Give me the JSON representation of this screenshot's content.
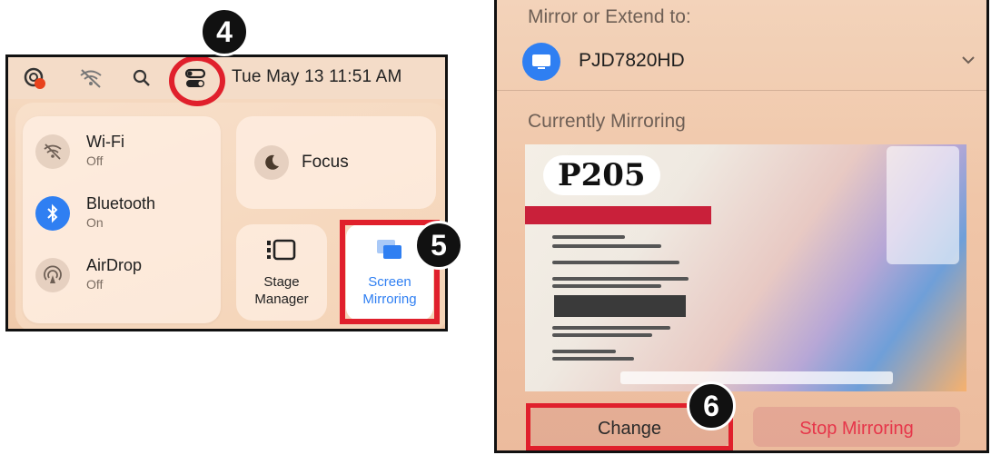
{
  "left_panel": {
    "menubar": {
      "clock": "Tue May 13  11:51 AM",
      "icons": [
        "siri-icon",
        "wifi-off-icon",
        "search-icon",
        "control-center-icon"
      ]
    },
    "connectivity": [
      {
        "title": "Wi-Fi",
        "status": "Off",
        "icon": "wifi-off-icon"
      },
      {
        "title": "Bluetooth",
        "status": "On",
        "icon": "bluetooth-icon"
      },
      {
        "title": "AirDrop",
        "status": "Off",
        "icon": "airdrop-icon"
      }
    ],
    "focus": {
      "label": "Focus",
      "icon": "moon-icon"
    },
    "stage_manager": {
      "label_line1": "Stage",
      "label_line2": "Manager"
    },
    "screen_mirroring": {
      "label_line1": "Screen",
      "label_line2": "Mirroring"
    },
    "step_badges": {
      "control_center": "4",
      "screen_mirroring": "5"
    }
  },
  "right_panel": {
    "mirror_heading": "Mirror or Extend to:",
    "display_name": "PJD7820HD",
    "current_heading": "Currently Mirroring",
    "preview_badge": "P205",
    "change_label": "Change",
    "stop_label": "Stop Mirroring",
    "step_badge": "6"
  },
  "colors": {
    "accent_blue": "#2f7ff2",
    "highlight_red": "#e0202c",
    "stop_red": "#e6364a"
  }
}
